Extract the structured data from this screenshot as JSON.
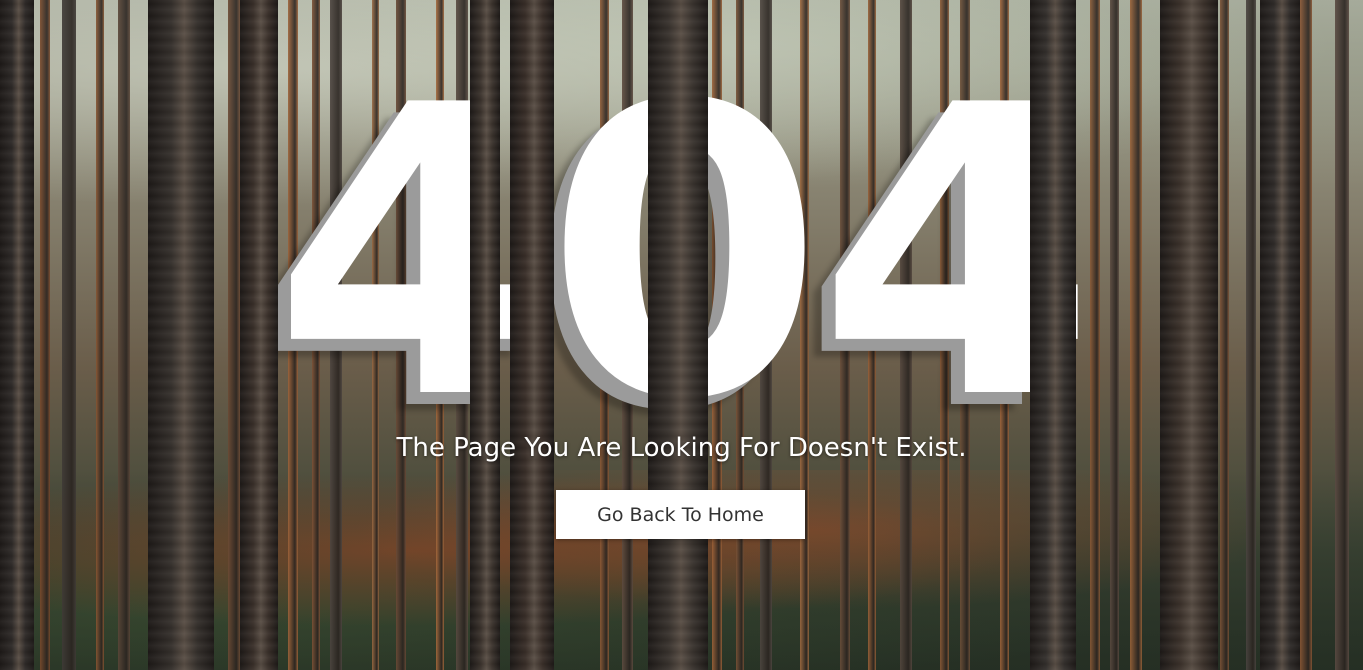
{
  "error": {
    "code": "404",
    "message": "The Page You Are Looking For Doesn't Exist."
  },
  "actions": {
    "home_label": "Go Back To Home"
  },
  "colors": {
    "headline": "#ffffff",
    "headline_shadow": "#9b9b9b",
    "button_background": "#ffffff",
    "button_text": "#333333"
  }
}
